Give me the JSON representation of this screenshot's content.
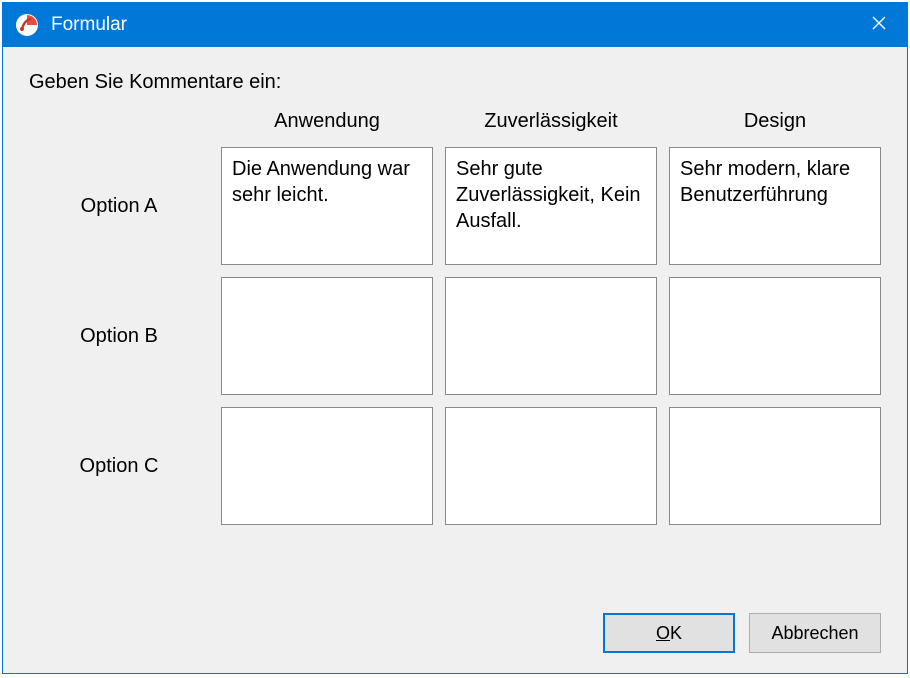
{
  "window": {
    "title": "Formular"
  },
  "prompt": "Geben Sie Kommentare ein:",
  "columns": [
    "Anwendung",
    "Zuverlässigkeit",
    "Design"
  ],
  "rows": [
    {
      "label": "Option A",
      "cells": [
        "Die Anwendung war sehr leicht.",
        "Sehr gute Zuverlässigkeit, Kein Ausfall.",
        "Sehr modern, klare Benutzerführung"
      ]
    },
    {
      "label": "Option B",
      "cells": [
        "",
        "",
        ""
      ]
    },
    {
      "label": "Option C",
      "cells": [
        "",
        "",
        ""
      ]
    }
  ],
  "buttons": {
    "ok": "OK",
    "cancel": "Abbrechen"
  }
}
